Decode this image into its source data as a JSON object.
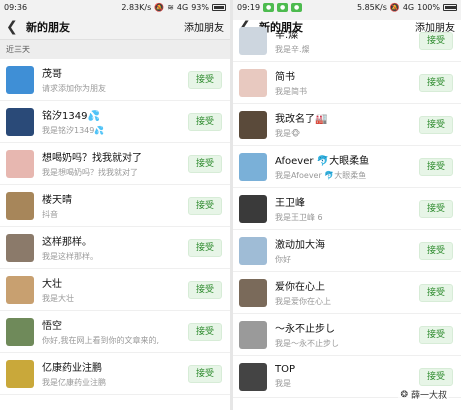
{
  "left": {
    "status": {
      "time": "09:36",
      "speed": "2.83K/s",
      "network": "4G",
      "battery": "93%"
    },
    "header": {
      "title": "新的朋友",
      "action": "添加朋友"
    },
    "section": "近三天",
    "items": [
      {
        "name": "茂哥",
        "sub": "请求添加你为朋友",
        "accept": "接受",
        "color": "#3f8fd6"
      },
      {
        "name": "铭汐1349💦",
        "sub": "我是铭汐1349💦",
        "accept": "接受",
        "color": "#2a4a78"
      },
      {
        "name": "想喝奶吗？找我就对了",
        "sub": "我是想喝奶吗？找我就对了",
        "accept": "接受",
        "color": "#e7b7b0"
      },
      {
        "name": "楼天晴",
        "sub": "抖音",
        "accept": "接受",
        "color": "#a7865a"
      },
      {
        "name": "这样那样。",
        "sub": "我是这样那样。",
        "accept": "接受",
        "color": "#8b7a6a"
      },
      {
        "name": "大壮",
        "sub": "我是大壮",
        "accept": "接受",
        "color": "#c8a070"
      },
      {
        "name": "悟空",
        "sub": "你好,我在网上看到你的文章来的,",
        "accept": "接受",
        "color": "#6f8a5a"
      },
      {
        "name": "亿康药业注鹏",
        "sub": "我是亿康药业注鹏",
        "accept": "接受",
        "color": "#c9a83a"
      }
    ]
  },
  "right": {
    "status": {
      "time": "09:19",
      "speed": "5.85K/s",
      "network": "4G",
      "battery": "100%"
    },
    "header": {
      "title": "新的朋友",
      "action": "添加朋友"
    },
    "items": [
      {
        "name": "辛.燦",
        "sub": "我是辛.燦",
        "accept": "接受",
        "color": "#cdd6df"
      },
      {
        "name": "简书",
        "sub": "我是简书",
        "accept": "接受",
        "color": "#e8c9c0"
      },
      {
        "name": "我改名了🏭",
        "sub": "我是🐵",
        "accept": "接受",
        "color": "#5a4a3a"
      },
      {
        "name": "Afoever 🐬大眼柔鱼",
        "sub": "我是Afoever 🐬大眼柔鱼",
        "accept": "接受",
        "color": "#7ab0d8"
      },
      {
        "name": "王卫峰",
        "sub": "我是王卫峰 6",
        "accept": "接受",
        "color": "#3a3a3a"
      },
      {
        "name": "激动加大海",
        "sub": "你好",
        "accept": "接受",
        "color": "#9fbcd6"
      },
      {
        "name": "爱你在心上",
        "sub": "我是爱你在心上",
        "accept": "接受",
        "color": "#7a6a5a"
      },
      {
        "name": "～永不止步し",
        "sub": "我是～永不止步し",
        "accept": "接受",
        "color": "#9a9a9a"
      },
      {
        "name": "TOP",
        "sub": "我是",
        "accept": "接受",
        "color": "#444444"
      }
    ],
    "watermark": "薛一大叔"
  }
}
